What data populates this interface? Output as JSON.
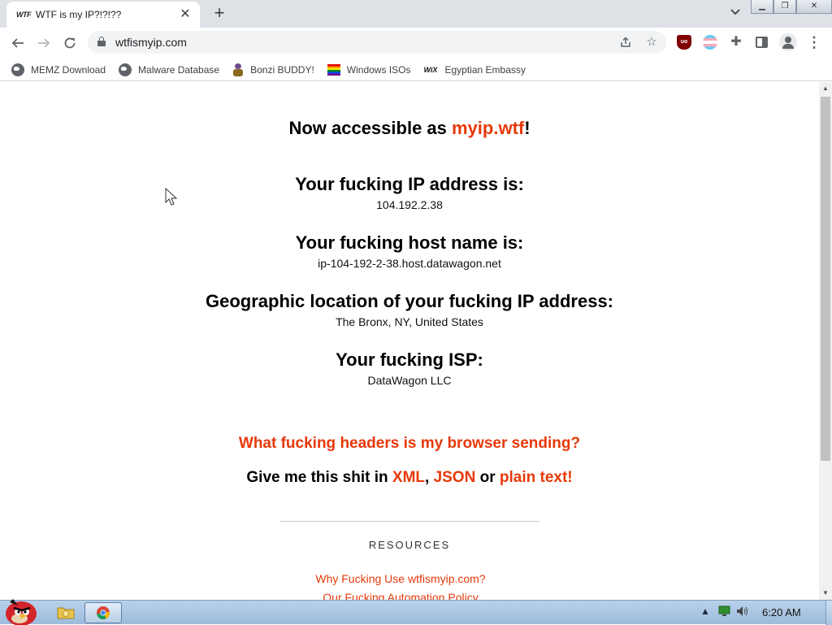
{
  "browser": {
    "tab": {
      "favicon_text": "WTF",
      "title": "WTF is my IP?!?!??"
    },
    "address": "wtfismyip.com",
    "bookmarks": [
      {
        "label": "MEMZ Download",
        "icon": "globe-icon"
      },
      {
        "label": "Malware Database",
        "icon": "globe-icon"
      },
      {
        "label": "Bonzi BUDDY!",
        "icon": "bonzi-icon"
      },
      {
        "label": "Windows ISOs",
        "icon": "rainbow-flag-icon"
      },
      {
        "label": "Egyptian Embassy",
        "icon": "wix-icon",
        "icon_text": "WiX"
      }
    ],
    "extensions": {
      "ublock_text": "uo"
    }
  },
  "page": {
    "headline": {
      "prefix": "Now accessible as ",
      "link": "myip.wtf",
      "suffix": "!"
    },
    "ip": {
      "label": "Your fucking IP address is:",
      "value": "104.192.2.38"
    },
    "host": {
      "label": "Your fucking host name is:",
      "value": "ip-104-192-2-38.host.datawagon.net"
    },
    "geo": {
      "label": "Geographic location of your fucking IP address:",
      "value": "The Bronx, NY, United States"
    },
    "isp": {
      "label": "Your fucking ISP:",
      "value": "DataWagon LLC"
    },
    "headers_link": "What fucking headers is my browser sending?",
    "formats": {
      "prefix": "Give me this shit in ",
      "xml": "XML",
      "comma": ", ",
      "json": "JSON",
      "or": " or ",
      "plain": "plain text!"
    },
    "resources": {
      "heading": "RESOURCES",
      "links": [
        "Why Fucking Use wtfismyip.com?",
        "Our Fucking Automation Policy"
      ]
    }
  },
  "taskbar": {
    "clock": "6:20 AM"
  },
  "colors": {
    "accent": "#e6390a",
    "tabstrip": "#dee1e6",
    "taskbar": "#b9d1ea"
  }
}
